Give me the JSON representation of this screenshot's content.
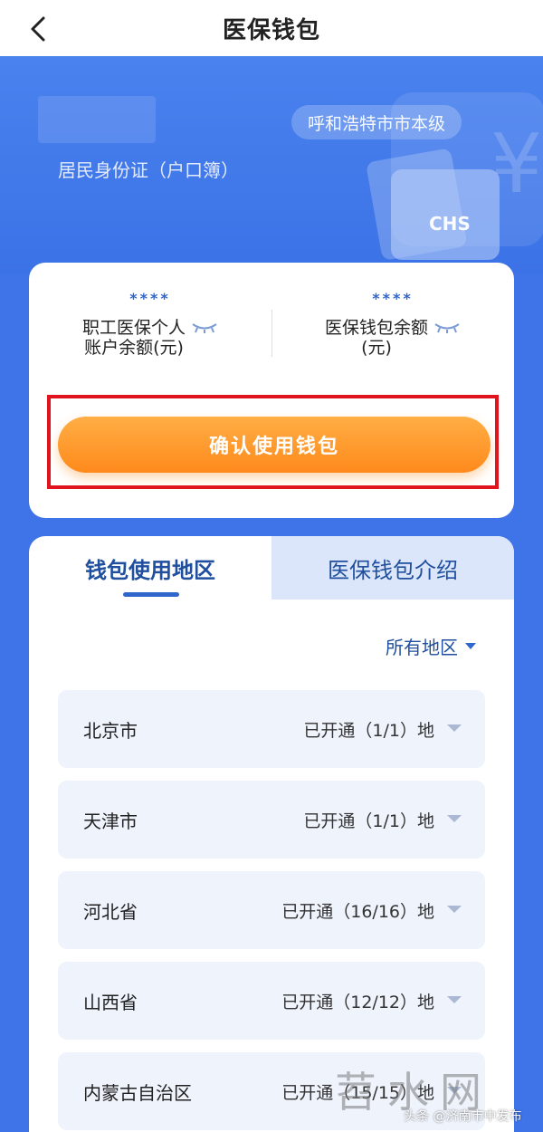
{
  "nav": {
    "title": "医保钱包",
    "back_icon": "chevron-left-icon"
  },
  "header": {
    "id_type": "居民身份证（户口簿）",
    "region_tag": "呼和浩特市市本级",
    "card_logo": "CHS"
  },
  "balances": {
    "left": {
      "masked_value": "****",
      "label_line1": "职工医保个人",
      "label_line2": "账户余额(元)"
    },
    "right": {
      "masked_value": "****",
      "label_line1": "医保钱包余额",
      "label_line2": "(元)"
    },
    "confirm_label": "确认使用钱包"
  },
  "tabs": [
    {
      "label": "钱包使用地区",
      "active": true
    },
    {
      "label": "医保钱包介绍",
      "active": false
    }
  ],
  "filter": {
    "label": "所有地区"
  },
  "regions": [
    {
      "name": "北京市",
      "status": "已开通（1/1）地"
    },
    {
      "name": "天津市",
      "status": "已开通（1/1）地"
    },
    {
      "name": "河北省",
      "status": "已开通（16/16）地"
    },
    {
      "name": "山西省",
      "status": "已开通（12/12）地"
    },
    {
      "name": "内蒙古自治区",
      "status": "已开通（15/15）地"
    }
  ],
  "watermark": {
    "big": "苕水网",
    "small": "头条 @济南市中发布"
  },
  "colors": {
    "brand_blue": "#3f74e8",
    "accent_orange": "#ff8a1c",
    "highlight_red": "#e0141e",
    "tab_text": "#1f4f9e"
  }
}
